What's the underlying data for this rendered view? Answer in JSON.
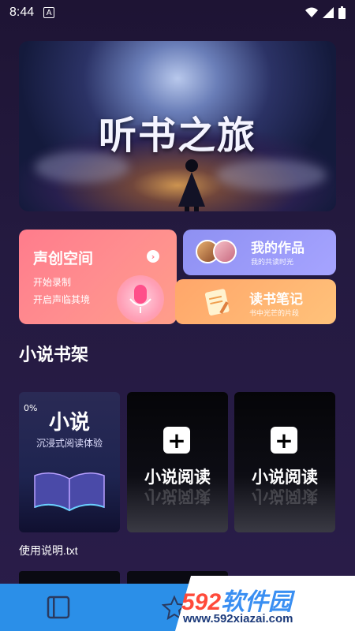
{
  "status_bar": {
    "time": "8:44",
    "indicator": "A"
  },
  "banner": {
    "title": "听书之旅"
  },
  "cards": {
    "create": {
      "title": "声创空间",
      "line1": "开始录制",
      "line2": "开启声临其境"
    },
    "works": {
      "title": "我的作品",
      "subtitle": "我的共读时光"
    },
    "notes": {
      "title": "读书笔记",
      "subtitle": "书中光芒的片段"
    }
  },
  "shelf": {
    "title": "小说书架",
    "books": [
      {
        "progress": "0%",
        "title": "小说",
        "subtitle": "沉浸式阅读体验",
        "file": "使用说明.txt"
      },
      {
        "label": "小说阅读"
      },
      {
        "label": "小说阅读"
      }
    ]
  },
  "watermark": {
    "brand_num": "592",
    "brand_cn": "软件园",
    "url": "www.592xiazai.com"
  },
  "colors": {
    "accent_nav": "#2b8fe8",
    "create_card": "#ff7c8c",
    "works_card": "#8e90f2",
    "notes_card": "#ffa66a"
  },
  "icons": [
    "wifi-icon",
    "signal-icon",
    "battery-icon",
    "arrow-right-icon",
    "microphone-icon",
    "notepad-icon",
    "plus-icon",
    "bookshelf-icon",
    "star-icon"
  ]
}
